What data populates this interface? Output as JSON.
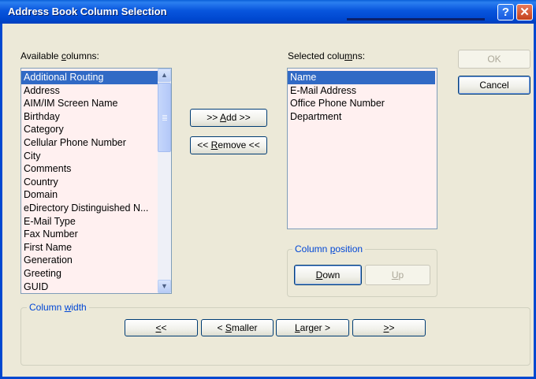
{
  "window": {
    "title": "Address Book Column Selection",
    "help_glyph": "?",
    "close_glyph": "✕"
  },
  "available": {
    "label_pre": "Available ",
    "label_key": "c",
    "label_post": "olumns:",
    "items": [
      "Additional Routing",
      "Address",
      "AIM/IM Screen Name",
      "Birthday",
      "Category",
      "Cellular Phone Number",
      "City",
      "Comments",
      "Country",
      "Domain",
      "eDirectory Distinguished N...",
      "E-Mail Type",
      "Fax Number",
      "First Name",
      "Generation",
      "Greeting",
      "GUID"
    ],
    "selected_index": 0
  },
  "selected": {
    "label_pre": "Selected colu",
    "label_key": "m",
    "label_post": "ns:",
    "items": [
      "Name",
      "E-Mail Address",
      "Office Phone Number",
      "Department"
    ],
    "selected_index": 0
  },
  "buttons": {
    "add_pre": ">> ",
    "add_key": "A",
    "add_post": "dd >>",
    "remove_pre": "<< ",
    "remove_key": "R",
    "remove_post": "emove <<",
    "ok": "OK",
    "cancel": "Cancel"
  },
  "position": {
    "label_pre": "Column ",
    "label_key": "p",
    "label_post": "osition",
    "down_key": "D",
    "down_post": "own",
    "up_key": "U",
    "up_post": "p"
  },
  "width": {
    "label_pre": "Column ",
    "label_key": "w",
    "label_post": "idth",
    "first_key": "<",
    "first_post": "<",
    "smaller_pre": "< ",
    "smaller_key": "S",
    "smaller_post": "maller",
    "larger_key": "L",
    "larger_post": "arger >",
    "last_key": ">",
    "last_post": ">"
  },
  "scroll": {
    "up_glyph": "▲",
    "down_glyph": "▼"
  },
  "colors": {
    "title_bar": "#0048d0",
    "selection": "#316ac5",
    "list_bg": "#fff0f0",
    "group_label": "#0046d5"
  }
}
